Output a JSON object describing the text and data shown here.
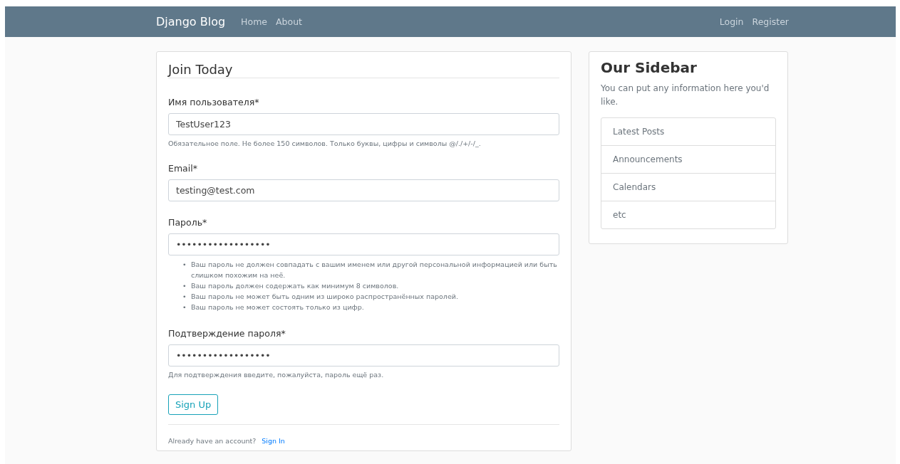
{
  "navbar": {
    "brand": "Django Blog",
    "left_links": [
      "Home",
      "About"
    ],
    "right_links": [
      "Login",
      "Register"
    ]
  },
  "form": {
    "title": "Join Today",
    "fields": [
      {
        "label": "Имя пользователя*",
        "value": "TestUser123",
        "help": "Обязательное поле. Не более 150 символов. Только буквы, цифры и символы @/./+/-/_."
      },
      {
        "label": "Email*",
        "value": "testing@test.com"
      },
      {
        "label": "Пароль*",
        "value": "••••••••••••••••••",
        "bullet": "•",
        "help_list": [
          "Ваш пароль не должен совпадать с вашим именем или другой персональной информацией или быть слишком похожим на неё.",
          "Ваш пароль должен содержать как минимум 8 символов.",
          "Ваш пароль не может быть одним из широко распространённых паролей.",
          "Ваш пароль не может состоять только из цифр."
        ]
      },
      {
        "label": "Подтверждение пароля*",
        "value": "••••••••••••••••••",
        "help": "Для подтверждения введите, пожалуйста, пароль ещё раз."
      }
    ],
    "submit": "Sign Up",
    "footer_text": "Already have an account?",
    "footer_link": "Sign In"
  },
  "sidebar": {
    "title": "Our Sidebar",
    "text": "You can put any information here you'd like.",
    "items": [
      "Latest Posts",
      "Announcements",
      "Calendars",
      "etc"
    ]
  }
}
